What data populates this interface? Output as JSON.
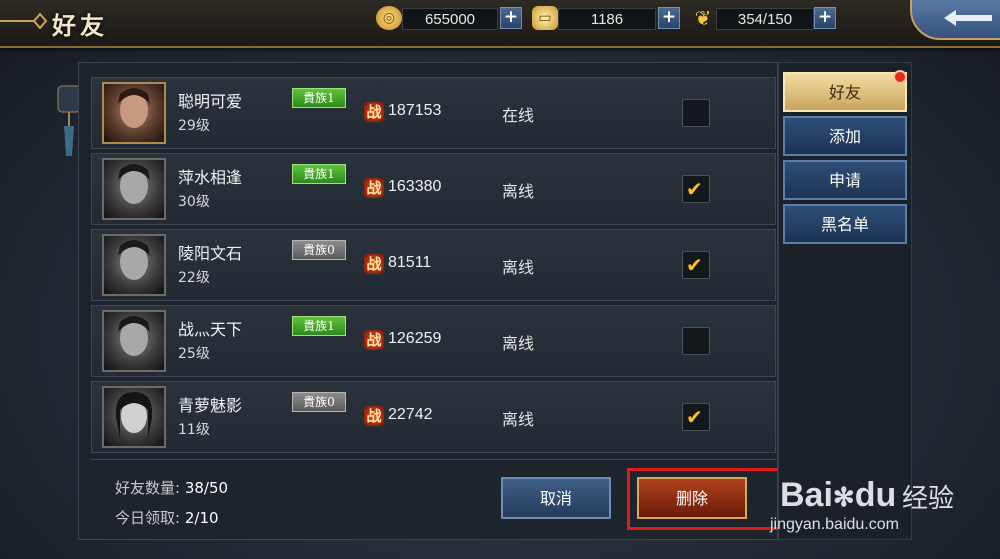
{
  "header": {
    "title": "好友",
    "resources": [
      {
        "icon": "gold-coin-icon",
        "value": "655000"
      },
      {
        "icon": "silver-ingot-icon",
        "value": "1186"
      },
      {
        "icon": "stamina-wheat-icon",
        "value": "354/150"
      }
    ],
    "plus_label": "+",
    "back_icon": "back-arrow-icon"
  },
  "friends": [
    {
      "name": "聪明可爱",
      "level": "29级",
      "badge": "貴族1",
      "badge_color": "green",
      "power_icon": "战",
      "power": "187153",
      "status": "在线",
      "selected": false,
      "avatar": "gold"
    },
    {
      "name": "萍水相逢",
      "level": "30级",
      "badge": "貴族1",
      "badge_color": "green",
      "power_icon": "战",
      "power": "163380",
      "status": "离线",
      "selected": true,
      "avatar": "gray"
    },
    {
      "name": "陵阳文石",
      "level": "22级",
      "badge": "貴族0",
      "badge_color": "gray",
      "power_icon": "战",
      "power": "81511",
      "status": "离线",
      "selected": true,
      "avatar": "gray"
    },
    {
      "name": "战灬天下",
      "level": "25级",
      "badge": "貴族1",
      "badge_color": "green",
      "power_icon": "战",
      "power": "126259",
      "status": "离线",
      "selected": false,
      "avatar": "gray"
    },
    {
      "name": "青萝魅影",
      "level": "11级",
      "badge": "貴族0",
      "badge_color": "gray",
      "power_icon": "战",
      "power": "22742",
      "status": "离线",
      "selected": true,
      "avatar": "gray"
    }
  ],
  "footer": {
    "friend_count_label": "好友数量:",
    "friend_count_value": "38/50",
    "daily_claim_label": "今日领取:",
    "daily_claim_value": "2/10",
    "cancel_label": "取消",
    "delete_label": "删除"
  },
  "tabs": [
    {
      "label": "好友",
      "active": true,
      "notify": true
    },
    {
      "label": "添加",
      "active": false,
      "notify": false
    },
    {
      "label": "申请",
      "active": false,
      "notify": false
    },
    {
      "label": "黑名单",
      "active": false,
      "notify": false
    }
  ],
  "watermark": {
    "brand": "Bai",
    "brand2": "du",
    "cn": "经验",
    "url": "jingyan.baidu.com"
  },
  "colors": {
    "accent_gold": "#c9a55c",
    "highlight_red": "#e01b1b",
    "check_yellow": "#ffc41c"
  }
}
